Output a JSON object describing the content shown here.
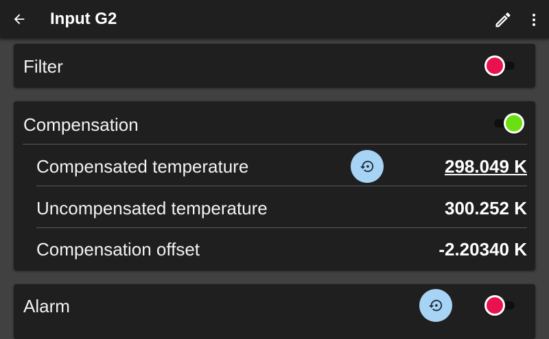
{
  "app_bar": {
    "title": "Input G2",
    "icons": {
      "back": "arrow-back-icon",
      "edit": "pencil-icon",
      "more": "more-vert-icon"
    }
  },
  "cards": {
    "filter": {
      "title": "Filter",
      "enabled": false
    },
    "compensation": {
      "title": "Compensation",
      "enabled": true,
      "rows": [
        {
          "label": "Compensated temperature",
          "value": "298.049 K",
          "resettable": true
        },
        {
          "label": "Uncompensated temperature",
          "value": "300.252 K"
        },
        {
          "label": "Compensation offset",
          "value": "-2.20340 K"
        }
      ]
    },
    "alarm": {
      "title": "Alarm",
      "enabled": false,
      "resettable": true
    }
  },
  "colors": {
    "background": "#414141",
    "surface": "#1f1f1f",
    "toggle_off": "#e8124f",
    "toggle_on": "#6be011",
    "reset_button": "#a7d3f5",
    "reset_icon": "#1a2a38"
  }
}
